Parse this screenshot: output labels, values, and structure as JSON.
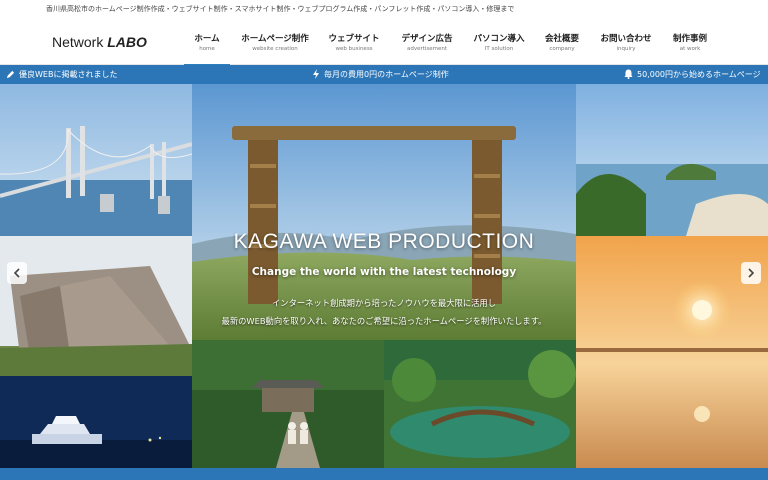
{
  "top_bar": {
    "text": "香川県高松市のホームページ制作作成・ウェブサイト制作・スマホサイト制作・ウェブプログラム作成・パンフレット作成・パソコン導入・修理まで"
  },
  "logo": {
    "part1": "Network ",
    "part2": "LABO"
  },
  "nav": [
    {
      "label": "ホーム",
      "sub": "home"
    },
    {
      "label": "ホームページ制作",
      "sub": "website creation"
    },
    {
      "label": "ウェブサイト",
      "sub": "web business"
    },
    {
      "label": "デザイン広告",
      "sub": "advertisement"
    },
    {
      "label": "パソコン導入",
      "sub": "IT solution"
    },
    {
      "label": "会社概要",
      "sub": "company"
    },
    {
      "label": "お問い合わせ",
      "sub": "inquiry"
    },
    {
      "label": "制作事例",
      "sub": "at work"
    }
  ],
  "ticker": [
    {
      "icon": "pencil-icon",
      "text": "優良WEBに掲載されました"
    },
    {
      "icon": "bolt-icon",
      "text": "毎月の費用0円のホームページ制作"
    },
    {
      "icon": "bell-icon",
      "text": "50,000円から始めるホームページ"
    }
  ],
  "hero": {
    "title": "KAGAWA WEB PRODUCTION",
    "subtitle": "Change the world with the latest technology",
    "desc1": "インターネット創成期から培ったノウハウを最大限に活用し",
    "desc2": "最新のWEB動向を取り入れ、あなたのご希望に沿ったホームページを制作いたします。"
  },
  "colors": {
    "accent": "#2c76b8"
  }
}
